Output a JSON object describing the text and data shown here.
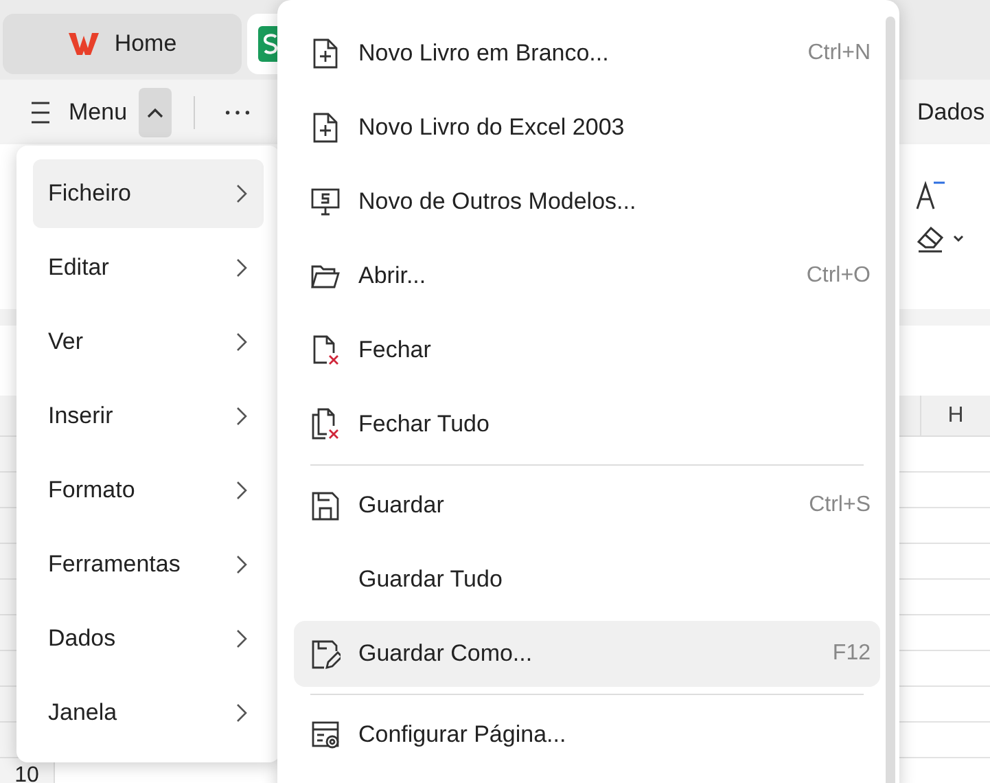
{
  "tabs": [
    {
      "label": "Home",
      "selected": false
    },
    {
      "selected": true
    }
  ],
  "toolbar": {
    "menu_label": "Menu",
    "expanded": true,
    "ribbon_tab": "Dados"
  },
  "sheet": {
    "column_header": "H",
    "row_number": "10"
  },
  "main_menu": {
    "items": [
      {
        "label": "Ficheiro",
        "selected": true
      },
      {
        "label": "Editar",
        "selected": false
      },
      {
        "label": "Ver",
        "selected": false
      },
      {
        "label": "Inserir",
        "selected": false
      },
      {
        "label": "Formato",
        "selected": false
      },
      {
        "label": "Ferramentas",
        "selected": false
      },
      {
        "label": "Dados",
        "selected": false
      },
      {
        "label": "Janela",
        "selected": false
      }
    ]
  },
  "file_menu": {
    "items": [
      {
        "kind": "command",
        "label": "Novo Livro em Branco...",
        "shortcut": "Ctrl+N",
        "selected": false
      },
      {
        "kind": "command",
        "label": "Novo Livro do Excel 2003",
        "selected": false
      },
      {
        "kind": "command",
        "label": "Novo de Outros Modelos...",
        "selected": false
      },
      {
        "kind": "command",
        "label": "Abrir...",
        "shortcut": "Ctrl+O",
        "selected": false
      },
      {
        "kind": "command",
        "label": "Fechar",
        "selected": false
      },
      {
        "kind": "command",
        "label": "Fechar Tudo",
        "selected": false
      },
      {
        "kind": "separator"
      },
      {
        "kind": "command",
        "label": "Guardar",
        "shortcut": "Ctrl+S",
        "selected": false
      },
      {
        "kind": "command",
        "label": "Guardar Tudo",
        "selected": false
      },
      {
        "kind": "command",
        "label": "Guardar Como...",
        "shortcut": "F12",
        "selected": true
      },
      {
        "kind": "separator"
      },
      {
        "kind": "command",
        "label": "Configurar Página...",
        "selected": false
      }
    ]
  }
}
